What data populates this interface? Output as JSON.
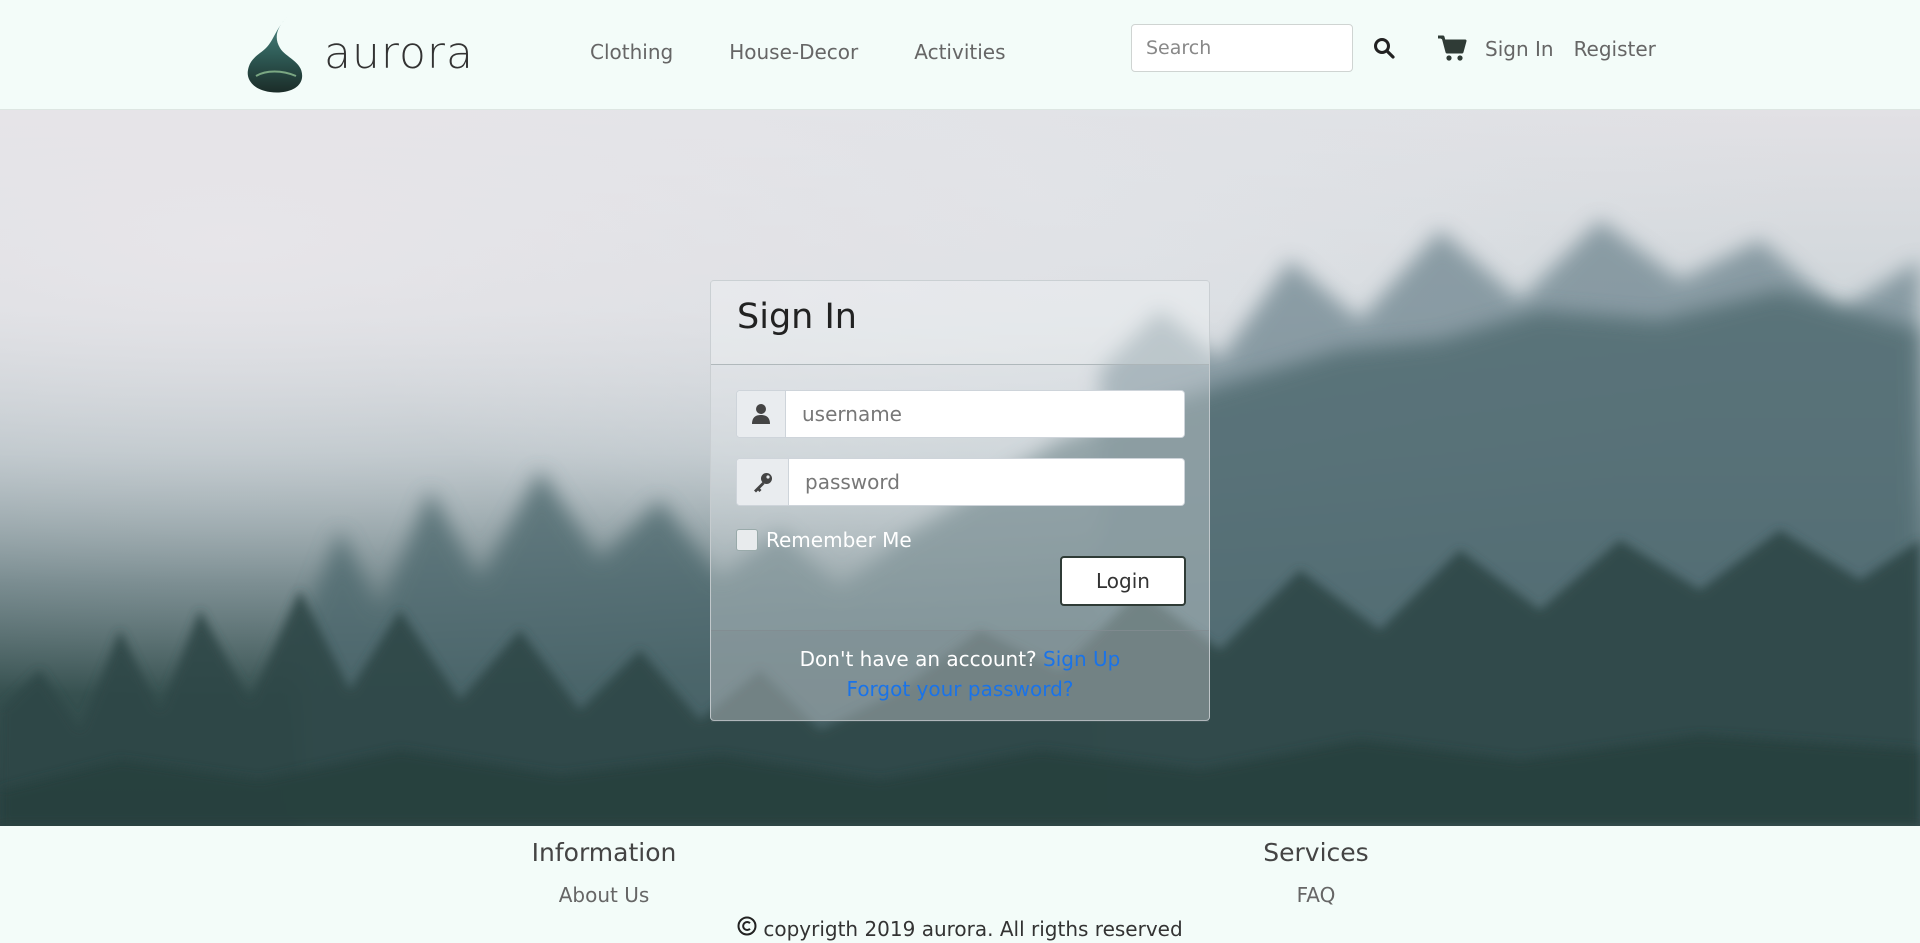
{
  "brand": {
    "name": "aurora",
    "logo_icon": "leaf-logo-icon"
  },
  "nav": {
    "items": [
      {
        "label": "Clothing"
      },
      {
        "label": "House-Decor"
      },
      {
        "label": "Activities"
      }
    ]
  },
  "search": {
    "placeholder": "Search",
    "value": "",
    "icon": "search-icon"
  },
  "account": {
    "cart_icon": "cart-icon",
    "sign_in": "Sign In",
    "register": "Register"
  },
  "login": {
    "title": "Sign In",
    "username_placeholder": "username",
    "password_placeholder": "password",
    "username_icon": "user-icon",
    "password_icon": "key-icon",
    "remember_label": "Remember Me",
    "remember_checked": false,
    "login_button": "Login",
    "no_account_text": "Don't have an account?",
    "sign_up_link": "Sign Up",
    "forgot_link": "Forgot your password?"
  },
  "footer": {
    "information": {
      "heading": "Information",
      "link": "About Us"
    },
    "services": {
      "heading": "Services",
      "link": "FAQ"
    },
    "copyright": "copyrigth 2019 aurora. All rigths reserved",
    "copyright_icon": "copyright-icon"
  },
  "colors": {
    "background": "#f3fcf9",
    "link": "#1a73e8",
    "button_border": "#2f3b36"
  }
}
